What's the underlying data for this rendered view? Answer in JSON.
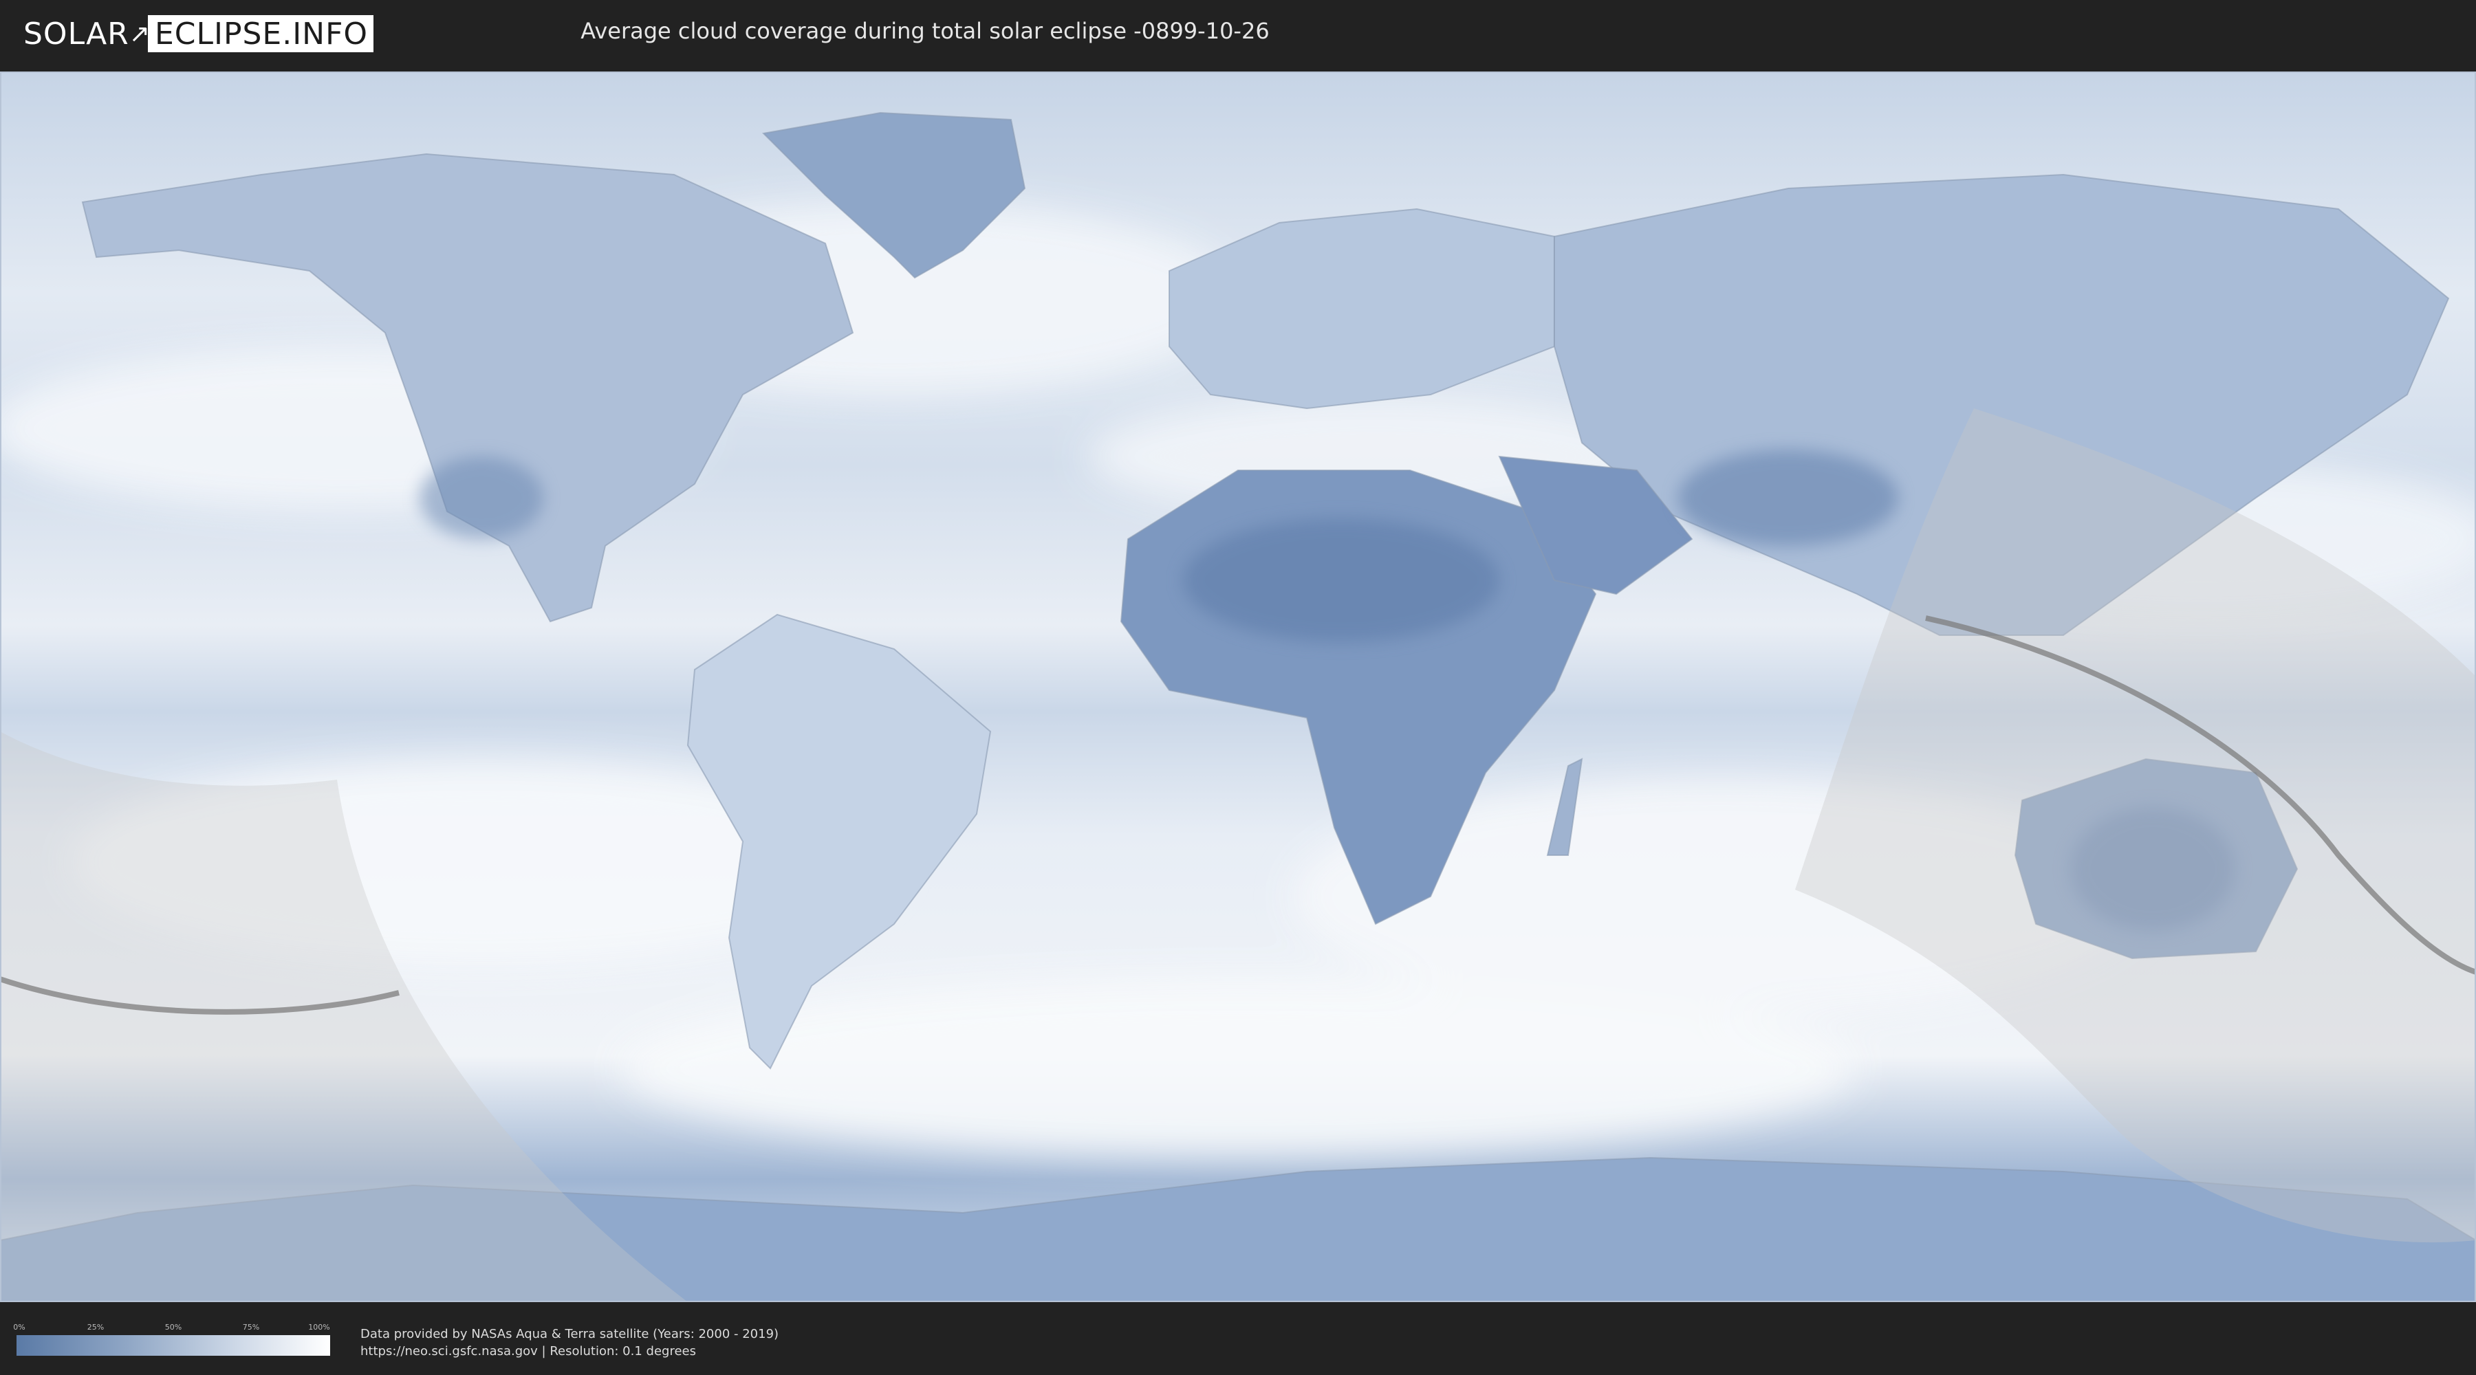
{
  "header": {
    "logo_left": "SOLAR",
    "logo_right": "ECLIPSE.INFO",
    "title": "Average cloud coverage during total solar eclipse -0899-10-26"
  },
  "legend": {
    "ticks": [
      "0%",
      "25%",
      "50%",
      "75%",
      "100%"
    ],
    "colors": {
      "low": "#5a7aa6",
      "high": "#ffffff"
    }
  },
  "footer": {
    "line1": "Data provided by NASAs Aqua & Terra satellite (Years: 2000 - 2019)",
    "line2": "https://neo.sci.gsfc.nasa.gov | Resolution: 0.1 degrees"
  },
  "map": {
    "projection": "equirectangular",
    "colors": {
      "ocean_cloud": "#e8eef6",
      "cloud_free": "#6f8fbb",
      "visibility_overlay": "#c9c9c9",
      "eclipse_path": "#7d7d7d",
      "borders": "#8a9bb3"
    }
  }
}
